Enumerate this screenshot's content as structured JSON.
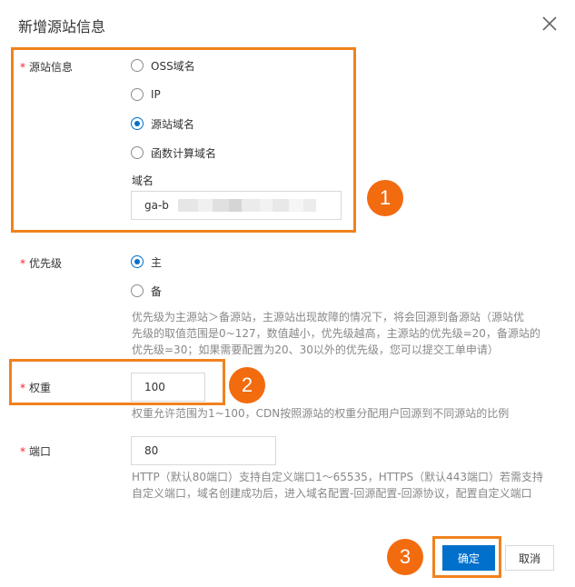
{
  "dialog": {
    "title": "新增源站信息",
    "close_icon": "close-icon"
  },
  "origin": {
    "label": "源站信息",
    "required_mark": "*",
    "options": [
      {
        "label": "OSS域名",
        "checked": false
      },
      {
        "label": "IP",
        "checked": false
      },
      {
        "label": "源站域名",
        "checked": true
      },
      {
        "label": "函数计算域名",
        "checked": false
      }
    ],
    "domain_label": "域名",
    "domain_value": "ga-b"
  },
  "priority": {
    "label": "优先级",
    "required_mark": "*",
    "options": [
      {
        "label": "主",
        "checked": true
      },
      {
        "label": "备",
        "checked": false
      }
    ],
    "help_lines": [
      "优先级为主源站＞备源站，主源站出现故障的情况下，将会回源到备源站（源站优",
      "先级的取值范围是0~127，数值越小，优先级越高，主源站的优先级=20，备源站的",
      "优先级=30；如果需要配置为20、30以外的优先级，您可以提交工单申请）"
    ]
  },
  "weight": {
    "label": "权重",
    "required_mark": "*",
    "value": "100",
    "help": "权重允许范围为1~100，CDN按照源站的权重分配用户回源到不同源站的比例"
  },
  "port": {
    "label": "端口",
    "required_mark": "*",
    "value": "80",
    "help_lines": [
      "HTTP（默认80端口）支持自定义端口1～65535，HTTPS（默认443端口）若需支持",
      "自定义端口，域名创建成功后，进入域名配置-回源配置-回源协议，配置自定义端口"
    ]
  },
  "footer": {
    "confirm_label": "确定",
    "cancel_label": "取消"
  },
  "annotations": {
    "step1": "1",
    "step2": "2",
    "step3": "3"
  },
  "colors": {
    "primary": "#0070cc",
    "highlight": "#f0821e",
    "badge": "#f26b0f",
    "required": "#f5222d"
  }
}
